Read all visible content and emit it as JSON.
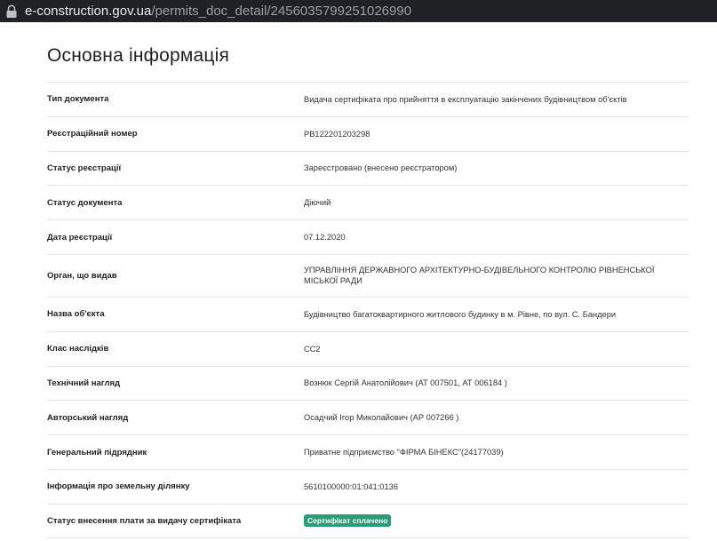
{
  "browser": {
    "url_host": "e-construction.gov.ua",
    "url_path": "/permits_doc_detail/2456035799251026990"
  },
  "page": {
    "title": "Основна інформація"
  },
  "fields": [
    {
      "label": "Тип документа",
      "value": "Видача сертифіката про прийняття в експлуатацію закінчених будівництвом об'єктів"
    },
    {
      "label": "Реєстраційний номер",
      "value": "РВ122201203298"
    },
    {
      "label": "Статус реєстрації",
      "value": "Зареєстровано (внесено реєстратором)"
    },
    {
      "label": "Статус документа",
      "value": "Діючий"
    },
    {
      "label": "Дата реєстрації",
      "value": "07.12.2020"
    },
    {
      "label": "Орган, що видав",
      "value": "УПРАВЛІННЯ ДЕРЖАВНОГО АРХІТЕКТУРНО-БУДІВЕЛЬНОГО КОНТРОЛЮ РІВНЕНСЬКОЇ МІСЬКОЇ РАДИ"
    },
    {
      "label": "Назва об'єкта",
      "value": "Будівництво багатоквартирного житлового будинку в м. Рівне, по вул. С. Бандери"
    },
    {
      "label": "Клас наслідків",
      "value": "СС2"
    },
    {
      "label": "Технічний нагляд",
      "value": "Вознюк Сергій Анатолійович (АТ 007501, АТ 006184 )"
    },
    {
      "label": "Авторський нагляд",
      "value": "Осадчий Ігор Миколайович (АР 007266 )"
    },
    {
      "label": "Генеральний підрядник",
      "value": "Приватне підприємство \"ФІРМА БІНЕКС\"(24177039)"
    },
    {
      "label": "Інформація про земельну ділянку",
      "value": "5610100000:01:041:0136"
    },
    {
      "label": "Статус внесення плати за видачу сертифіката",
      "badge": "Сертифікат сплачено"
    }
  ],
  "colors": {
    "badge_bg": "#2a9d76",
    "urlbar_bg": "#202124"
  }
}
